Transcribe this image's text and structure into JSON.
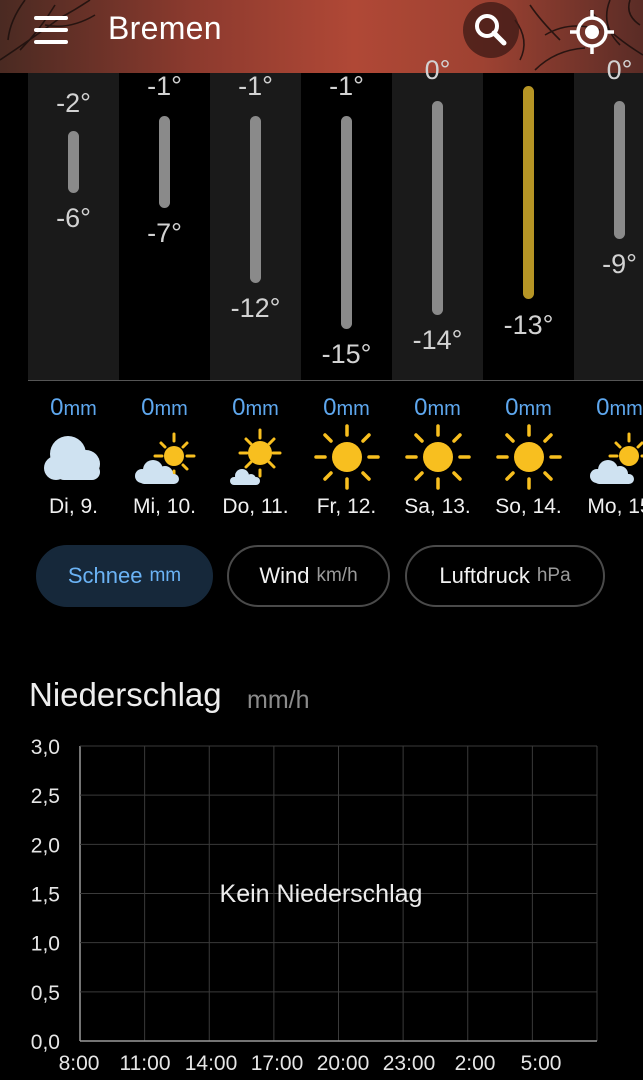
{
  "header": {
    "city": "Bremen",
    "menu_icon": "hamburger-menu-icon",
    "search_icon": "search-icon",
    "location_icon": "locate-icon"
  },
  "days": [
    {
      "high": "-2°",
      "low": "-6°",
      "high_value": -2,
      "low_value": -6
    },
    {
      "high": "-1°",
      "low": "-7°",
      "high_value": -1,
      "low_value": -7
    },
    {
      "high": "-1°",
      "low": "-12°",
      "high_value": -1,
      "low_value": -12
    },
    {
      "high": "-1°",
      "low": "-15°",
      "high_value": -1,
      "low_value": -15
    },
    {
      "high": "0°",
      "low": "-14°",
      "high_value": 0,
      "low_value": -14
    },
    {
      "high": "",
      "low": "-13°",
      "high_value": null,
      "low_value": -13
    },
    {
      "high": "0°",
      "low": "-9°",
      "high_value": 0,
      "low_value": -9
    }
  ],
  "forecast": [
    {
      "precip": "0",
      "unit": "mm",
      "icon": "cloudy-icon",
      "day": "Di, 9."
    },
    {
      "precip": "0",
      "unit": "mm",
      "icon": "partly-sunny-icon",
      "day": "Mi, 10."
    },
    {
      "precip": "0",
      "unit": "mm",
      "icon": "mostly-sunny-icon",
      "day": "Do, 11."
    },
    {
      "precip": "0",
      "unit": "mm",
      "icon": "sunny-icon",
      "day": "Fr, 12."
    },
    {
      "precip": "0",
      "unit": "mm",
      "icon": "sunny-icon",
      "day": "Sa, 13."
    },
    {
      "precip": "0",
      "unit": "mm",
      "icon": "sunny-icon",
      "day": "So, 14."
    },
    {
      "precip": "0",
      "unit": "mm",
      "icon": "partly-sunny-icon",
      "day": "Mo, 15"
    }
  ],
  "chips": [
    {
      "label": "Schnee",
      "unit": "mm",
      "active": true
    },
    {
      "label": "Wind",
      "unit": "km/h",
      "active": false
    },
    {
      "label": "Luftdruck",
      "unit": "hPa",
      "active": false
    }
  ],
  "chart": {
    "title": "Niederschlag",
    "unit": "mm/h",
    "message": "Kein Niederschlag"
  },
  "colors": {
    "precip_blue": "#5ea7ee",
    "active_chip_bg": "#16283a",
    "bar_gray": "#8a8a8a",
    "bar_highlight": "#b69525",
    "sun_yellow": "#f8bf1f",
    "cloud": "#cfe2f1"
  },
  "chart_data": {
    "type": "line",
    "title": "Niederschlag",
    "ylabel": "mm/h",
    "x": [
      "8:00",
      "11:00",
      "14:00",
      "17:00",
      "20:00",
      "23:00",
      "2:00",
      "5:00"
    ],
    "yticks": [
      "3,0",
      "2,5",
      "2,0",
      "1,5",
      "1,0",
      "0,5",
      "0,0"
    ],
    "ylim": [
      0,
      3
    ],
    "series": [],
    "annotation": "Kein Niederschlag",
    "grid": true
  }
}
